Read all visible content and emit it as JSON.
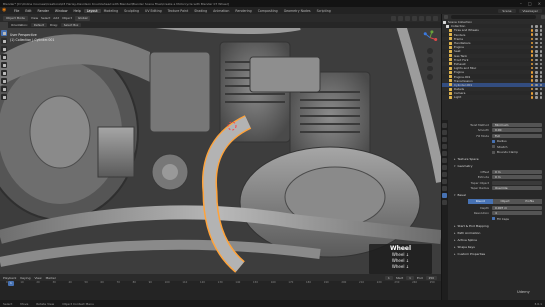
{
  "titlebar": {
    "title": "Blender* [D:\\Online Courses\\Creations\\03 Harley-Davidson Knucklehead with Blender\\Blender Scene Files\\Create a Motorcycle with Blender 07 Wheel]",
    "controls": [
      "–",
      "□",
      "×"
    ]
  },
  "menubar": {
    "menus": [
      "File",
      "Edit",
      "Render",
      "Window",
      "Help"
    ],
    "workspaces": [
      "Layout",
      "Modeling",
      "Sculpting",
      "UV Editing",
      "Texture Paint",
      "Shading",
      "Animation",
      "Rendering",
      "Compositing",
      "Geometry Nodes",
      "Scripting"
    ],
    "active_workspace": "Layout",
    "scene": "Scene",
    "view_layer": "ViewLayer"
  },
  "viewport_header": {
    "mode": "Object Mode",
    "menus": [
      "View",
      "Select",
      "Add",
      "Object"
    ],
    "orientation": "Global",
    "pivot": "Default",
    "snap": "Drag",
    "select": "Select Box",
    "options": "Options"
  },
  "viewport_sub": {
    "orientation_label": "Orientation:",
    "orientation_value": "Default",
    "drag_label": "Drag:",
    "drag_value": "Select Box"
  },
  "viewport_info": {
    "line1": "User Perspective",
    "line2": "(1) Collection | Cylinder.001"
  },
  "keystroke_overlay": {
    "title": "Wheel",
    "lines": [
      "Wheel ↓",
      "Wheel ↓",
      "Wheel ↓"
    ]
  },
  "timeline": {
    "menus": [
      "Playback",
      "Keying",
      "View",
      "Marker"
    ],
    "start_label": "Start",
    "start": "1",
    "end_label": "End",
    "end": "250",
    "current_frame": "1",
    "ruler": [
      "0",
      "10",
      "20",
      "30",
      "40",
      "50",
      "60",
      "70",
      "80",
      "90",
      "100",
      "110",
      "120",
      "130",
      "140",
      "150",
      "160",
      "170",
      "180",
      "190",
      "200",
      "210",
      "220",
      "230",
      "240",
      "250"
    ]
  },
  "statusbar": {
    "items": [
      "Select",
      "Move",
      "Rotate View",
      "Object Context Menu"
    ],
    "right": "3.0.1"
  },
  "outliner": {
    "items": [
      {
        "name": "Scene Collection",
        "type": "collection",
        "selected": false
      },
      {
        "name": "Collection",
        "type": "collection",
        "selected": false
      },
      {
        "name": "Tires and Wheels",
        "type": "object",
        "selected": false
      },
      {
        "name": "Fenders",
        "type": "object",
        "selected": false
      },
      {
        "name": "Frame",
        "type": "object",
        "selected": false
      },
      {
        "name": "Handlebars",
        "type": "object",
        "selected": false
      },
      {
        "name": "Engine",
        "type": "object",
        "selected": false
      },
      {
        "name": "Seat",
        "type": "object",
        "selected": false
      },
      {
        "name": "Gas Tank",
        "type": "object",
        "selected": false
      },
      {
        "name": "Front Fork",
        "type": "object",
        "selected": false
      },
      {
        "name": "Exhaust",
        "type": "object",
        "selected": false
      },
      {
        "name": "Lights and Misc",
        "type": "object",
        "selected": false
      },
      {
        "name": "Engine",
        "type": "object",
        "selected": false
      },
      {
        "name": "Engine.001",
        "type": "object",
        "selected": false
      },
      {
        "name": "Transmission",
        "type": "object",
        "selected": false
      },
      {
        "name": "Cylinder.001",
        "type": "object",
        "selected": true
      },
      {
        "name": "Details",
        "type": "object",
        "selected": false
      },
      {
        "name": "Camera",
        "type": "object",
        "selected": false
      },
      {
        "name": "Light",
        "type": "object",
        "selected": false
      }
    ]
  },
  "properties": {
    "fields": [
      {
        "label": "Twist Method",
        "value": "Minimum"
      },
      {
        "label": "Smooth",
        "value": "0.00"
      },
      {
        "label": "Fill Mode",
        "value": "Full"
      }
    ],
    "checks": [
      {
        "label": "Radius",
        "on": true
      },
      {
        "label": "Stretch",
        "on": false
      },
      {
        "label": "Bounds Clamp",
        "on": false
      }
    ],
    "section_texture": "Texture Space",
    "section_geometry": "Geometry",
    "geometry_fields": [
      {
        "label": "Offset",
        "value": "0 m"
      },
      {
        "label": "Extrude",
        "value": "0 m"
      },
      {
        "label": "Taper Object",
        "value": ""
      },
      {
        "label": "Taper Radius",
        "value": "Override"
      }
    ],
    "section_bevel": "Bevel",
    "bevel_modes": [
      "Round",
      "Object",
      "Profile"
    ],
    "bevel_active": "Round",
    "bevel_fields": [
      {
        "label": "Depth",
        "value": "0.007 m"
      },
      {
        "label": "Resolution",
        "value": "4"
      }
    ],
    "fill_caps_label": "Fill Caps",
    "sections_after": [
      "Start & End Mapping",
      "Path Animation",
      "Active Spline",
      "Shape Keys",
      "Custom Properties"
    ]
  },
  "watermark": "Udemy"
}
